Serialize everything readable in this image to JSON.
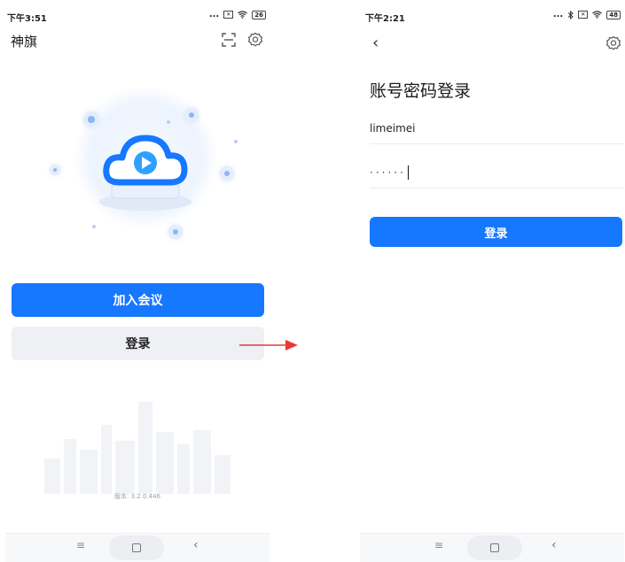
{
  "left_screen": {
    "status": {
      "time": "下午3:51",
      "dots": "...",
      "sim": "✕",
      "battery": "26"
    },
    "app_title": "神旗",
    "join_button_label": "加入会议",
    "login_button_label": "登录",
    "version_text": "版本: 3.2.0.446",
    "icons": [
      "scan-icon",
      "settings-icon"
    ]
  },
  "right_screen": {
    "status": {
      "time": "下午2:21",
      "dots": "...",
      "sim": "✕",
      "battery": "48"
    },
    "page_title": "账号密码登录",
    "username_value": "limeimei",
    "password_masked": "······",
    "login_button_label": "登录",
    "icons": [
      "back-icon",
      "settings-icon"
    ]
  },
  "nav": {
    "menu_symbol": "≡",
    "back_symbol": "‹"
  },
  "colors": {
    "primary": "#1677ff",
    "secondary_button": "#eef0f3",
    "arrow": "#e53935"
  }
}
